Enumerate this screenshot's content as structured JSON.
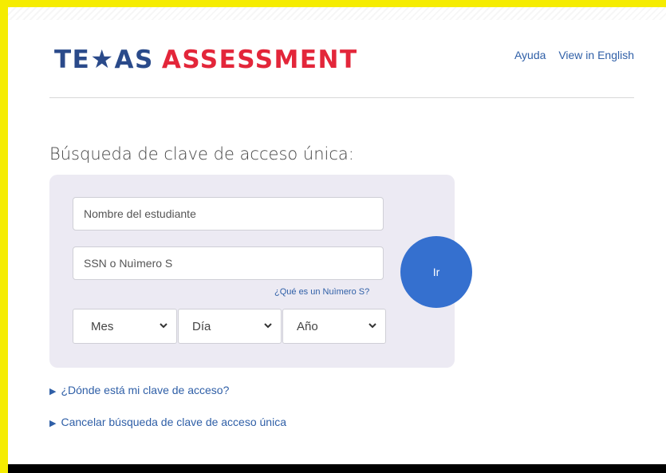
{
  "header": {
    "logo_part1": "TE",
    "logo_star": "★",
    "logo_part2": "AS",
    "logo_part3": "ASSESSMENT",
    "links": [
      "Ayuda",
      "View in English"
    ]
  },
  "page": {
    "heading": "Búsqueda de clave de acceso única:"
  },
  "form": {
    "student_name_placeholder": "Nombre del estudiante",
    "ssn_placeholder": "SSN o Nuìmero S",
    "help_link": "¿Qué es un Nuìmero S?",
    "month_select": "Mes",
    "day_select": "Día",
    "year_select": "Año",
    "go_button": "Ir"
  },
  "links": {
    "where_is_code": "¿Dónde está mi clave de acceso?",
    "cancel_search": "Cancelar búsqueda de clave de acceso única"
  },
  "colors": {
    "brand_blue": "#2a4a8a",
    "brand_red": "#e3263a",
    "link_blue": "#2f5fa7",
    "button_blue": "#3570cf",
    "panel_bg": "#eceaf3",
    "frame_yellow": "#f5ec00"
  }
}
